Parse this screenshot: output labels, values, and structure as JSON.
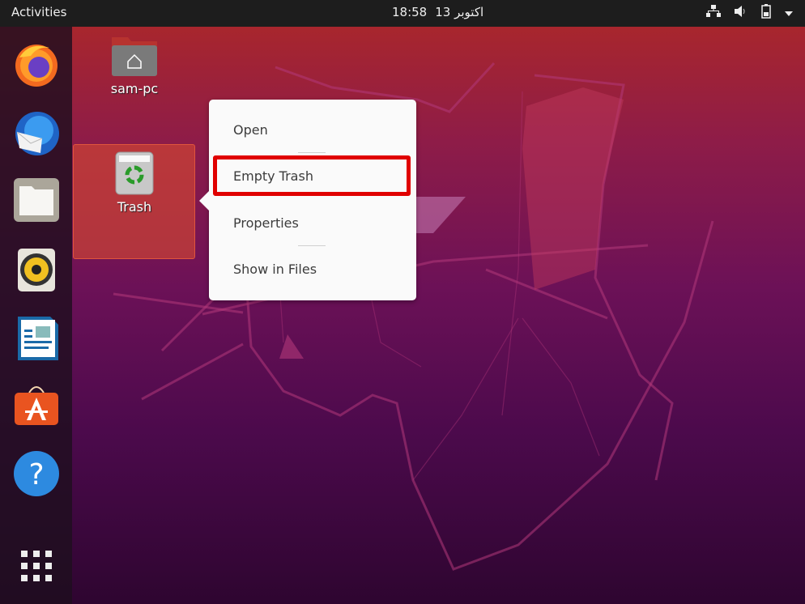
{
  "topbar": {
    "activities_label": "Activities",
    "clock_time": "18:58",
    "clock_date": "13 اکتوبر",
    "tray_icons": [
      "network-icon",
      "volume-icon",
      "battery-icon",
      "system-menu-arrow-icon"
    ]
  },
  "dock": {
    "items": [
      {
        "name": "Firefox",
        "icon": "firefox-icon"
      },
      {
        "name": "Thunderbird",
        "icon": "thunderbird-icon"
      },
      {
        "name": "Files",
        "icon": "files-icon"
      },
      {
        "name": "Rhythmbox",
        "icon": "rhythmbox-icon"
      },
      {
        "name": "LibreOffice Writer",
        "icon": "writer-icon"
      },
      {
        "name": "Ubuntu Software",
        "icon": "software-icon"
      },
      {
        "name": "Help",
        "icon": "help-icon"
      }
    ],
    "show_apps_icon": "app-grid-icon"
  },
  "desktop": {
    "icons": [
      {
        "label": "sam-pc",
        "icon": "home-folder-icon"
      },
      {
        "label": "Trash",
        "icon": "trash-icon",
        "selected": true
      }
    ]
  },
  "context_menu": {
    "items": [
      {
        "label": "Open"
      },
      {
        "label": "Empty Trash",
        "highlighted": true
      },
      {
        "label": "Properties"
      },
      {
        "label": "Show in Files"
      }
    ]
  },
  "colors": {
    "highlight_box": "#e00000",
    "topbar": "#1d1d1d",
    "selection": "#d2462f"
  }
}
